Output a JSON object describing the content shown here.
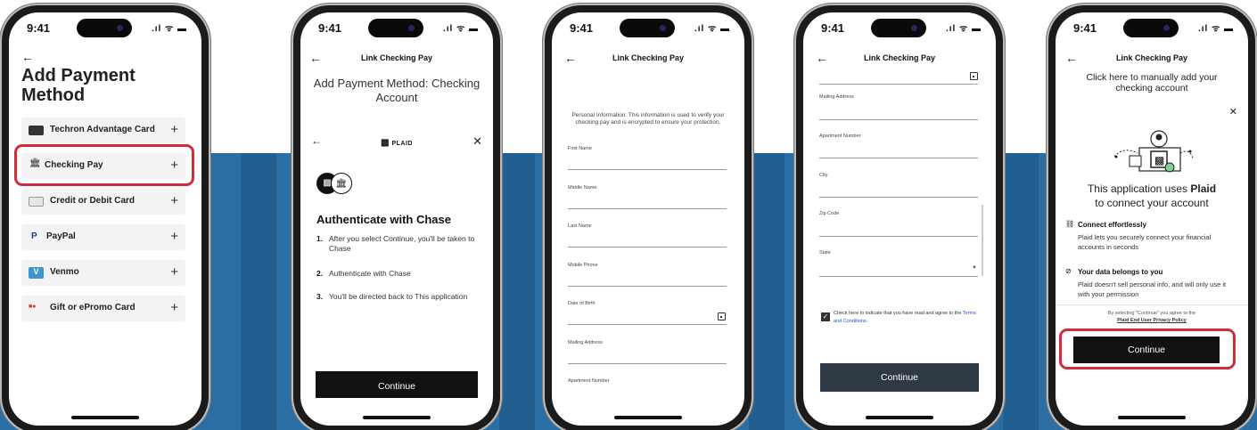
{
  "status": {
    "time": "9:41",
    "signal": ".ıl ᯤ ▬"
  },
  "phone1": {
    "back": "←",
    "title": "Add Payment Method",
    "items": [
      {
        "label": "Techron Advantage Card",
        "icon": "card-icon"
      },
      {
        "label": "Checking Pay",
        "icon": "bank-icon"
      },
      {
        "label": "Credit or Debit Card",
        "icon": "card-icon"
      },
      {
        "label": "PayPal",
        "icon": "paypal-icon"
      },
      {
        "label": "Venmo",
        "icon": "venmo-icon"
      },
      {
        "label": "Gift or ePromo Card",
        "icon": "gift-card-icon"
      }
    ],
    "plus": "+",
    "highlight_color": "#d22b3b"
  },
  "phone2": {
    "nav_title": "Link Checking Pay",
    "title": "Add Payment Method: Checking Account",
    "plaid": "PLAID",
    "heading": "Authenticate with Chase",
    "steps": [
      {
        "n": "1.",
        "text": "After you select Continue, you'll be taken to Chase"
      },
      {
        "n": "2.",
        "text": "Authenticate with Chase"
      },
      {
        "n": "3.",
        "text": "You'll be directed back to This application"
      }
    ],
    "continue": "Continue"
  },
  "phone3": {
    "nav_title": "Link Checking Pay",
    "info": "Personal Information: This information is used to verify your checking pay and is encrypted to ensure your protection.",
    "fields": [
      "First Name",
      "Middle Name",
      "Last Name",
      "Mobile Phone",
      "Date of Birth",
      "Mailing Address",
      "Apartment Number"
    ]
  },
  "phone4": {
    "nav_title": "Link Checking Pay",
    "fields": [
      "Mailing Address",
      "Apartment Number",
      "City",
      "Zip Code",
      "State"
    ],
    "agree_text": "Check here to indicate that you have read and agree to the",
    "terms_link": "Terms and Conditions.",
    "continue": "Continue"
  },
  "phone5": {
    "nav_title": "Link Checking Pay",
    "hint": "Click here to manually add your checking account",
    "heading_pre": "This application uses ",
    "heading_brand": "Plaid",
    "heading_post": "to connect your account",
    "features": [
      {
        "title": "Connect effortlessly",
        "desc": "Plaid lets you securely connect your financial accounts in seconds",
        "icon": "link-icon"
      },
      {
        "title": "Your data belongs to you",
        "desc": "Plaid doesn't sell personal info, and will only use it with your permission",
        "icon": "eye-off-icon"
      }
    ],
    "fine_print": "By selecting \"Continue\" you agree to the",
    "policy_link": "Plaid End User Privacy Policy",
    "continue": "Continue"
  }
}
